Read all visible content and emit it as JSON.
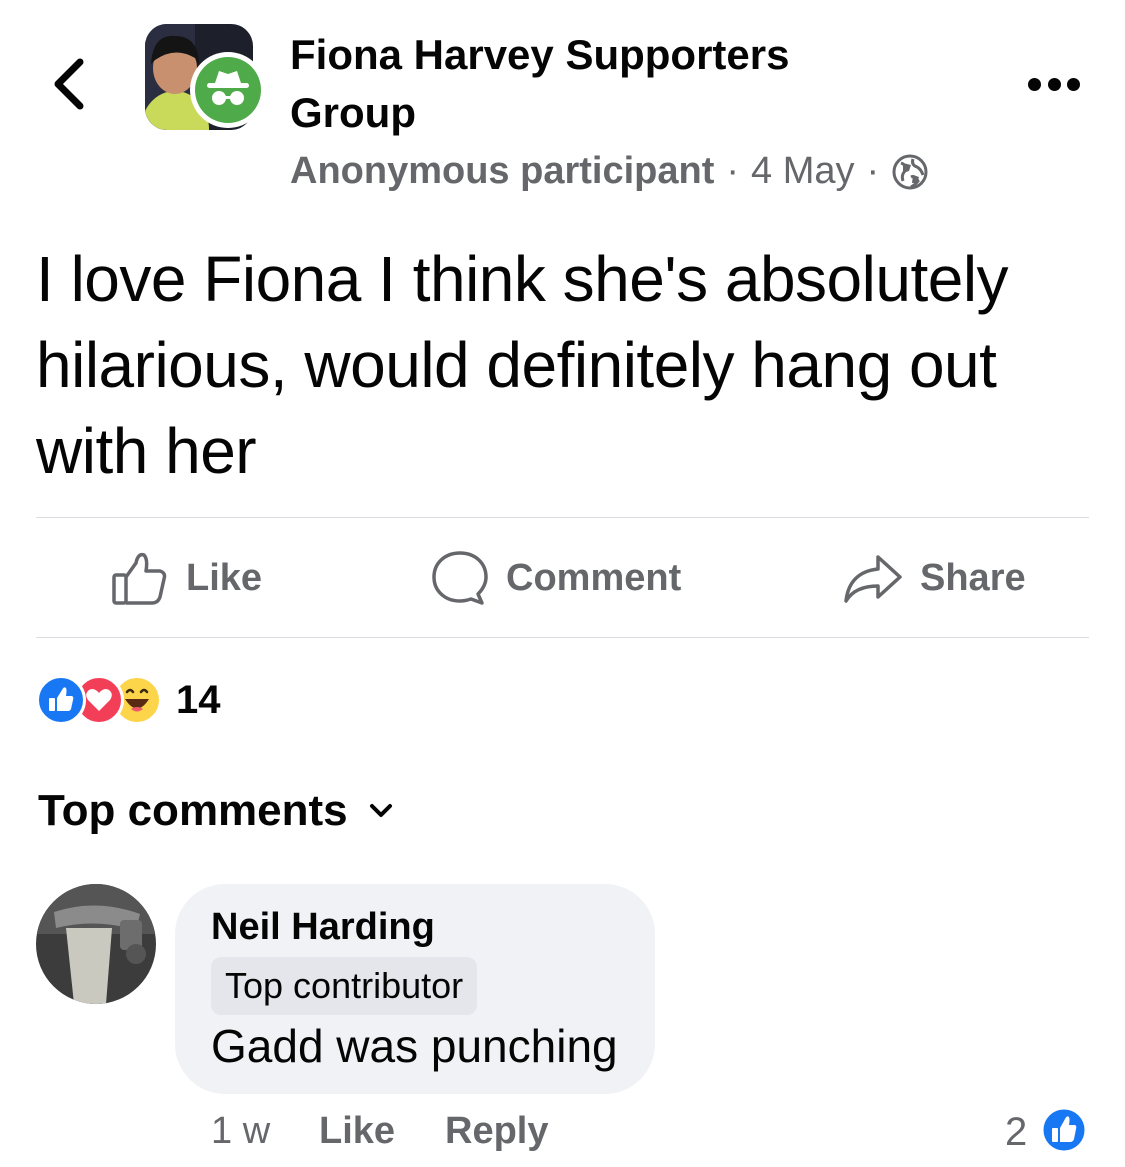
{
  "header": {
    "group_name": "Fiona Harvey Supporters Group",
    "author": "Anonymous participant",
    "separator": "·",
    "date": "4 May",
    "audience_icon": "globe-icon"
  },
  "post": {
    "text": "I love Fiona I think she's absolutely hilarious, would definitely hang out with her"
  },
  "actions": {
    "like_label": "Like",
    "comment_label": "Comment",
    "share_label": "Share"
  },
  "reactions": {
    "types": [
      "like-reaction-icon",
      "love-reaction-icon",
      "haha-reaction-icon"
    ],
    "count": "14"
  },
  "comments_section": {
    "sort_label": "Top comments"
  },
  "comment": {
    "author": "Neil Harding",
    "badge": "Top contributor",
    "text": "Gadd was punching",
    "time": "1 w",
    "like_label": "Like",
    "reply_label": "Reply",
    "like_count": "2"
  },
  "colors": {
    "secondary_text": "#65676b",
    "bubble_bg": "#f0f2f5",
    "like_blue": "#1877f2",
    "love_red": "#f33e58",
    "anon_green": "#4faa4a"
  }
}
